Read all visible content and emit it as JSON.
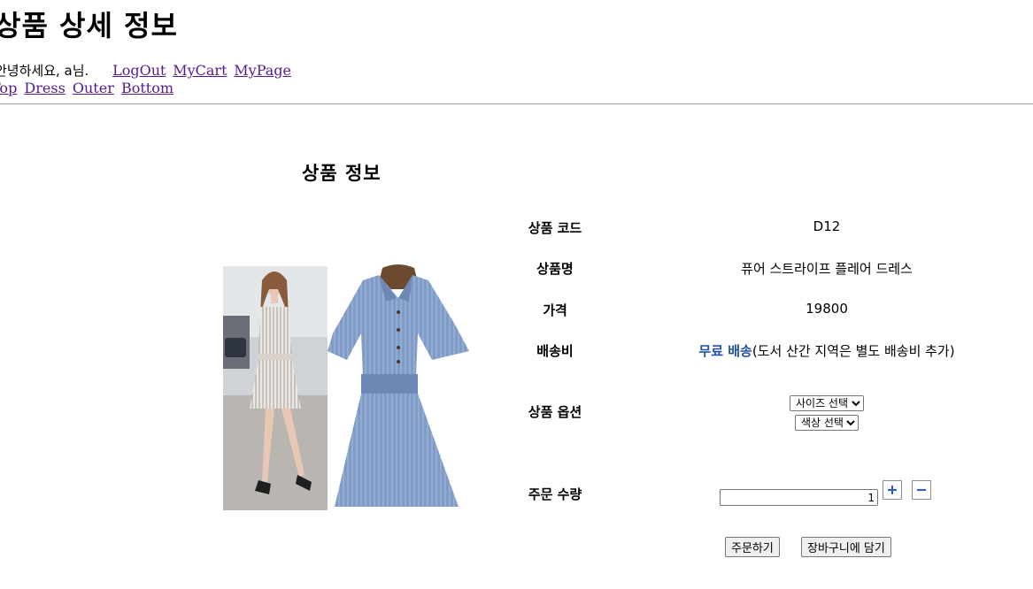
{
  "header": {
    "title": "상품 상세 정보",
    "greeting": "안녕하세요, a님.",
    "links": [
      "LogOut",
      "MyCart",
      "MyPage"
    ],
    "categories": [
      "Top",
      "Dress",
      "Outer",
      "Bottom"
    ]
  },
  "product": {
    "section_title": "상품 정보",
    "rows": {
      "code": {
        "label": "상품 코드",
        "value": "D12"
      },
      "name": {
        "label": "상품명",
        "value": "퓨어 스트라이프 플레어 드레스"
      },
      "price": {
        "label": "가격",
        "value": "19800"
      },
      "shipping": {
        "label": "배송비",
        "free": "무료 배송",
        "note": "(도서 산간 지역은 별도 배송비 추가)"
      },
      "options": {
        "label": "상품 옵션",
        "size_selected": "사이즈 선택",
        "color_selected": "색상 선택"
      },
      "quantity": {
        "label": "주문 수량",
        "value": "1"
      }
    },
    "buttons": {
      "order": "주문하기",
      "cart": "장바구니에 담기"
    }
  },
  "colors": {
    "link": "#551a8b",
    "free_shipping": "#2251a6",
    "dress": "#7f9bc6",
    "stepper_icon": "#2c5bd6"
  },
  "icons": {
    "plus": "plus-icon",
    "minus": "minus-icon"
  }
}
